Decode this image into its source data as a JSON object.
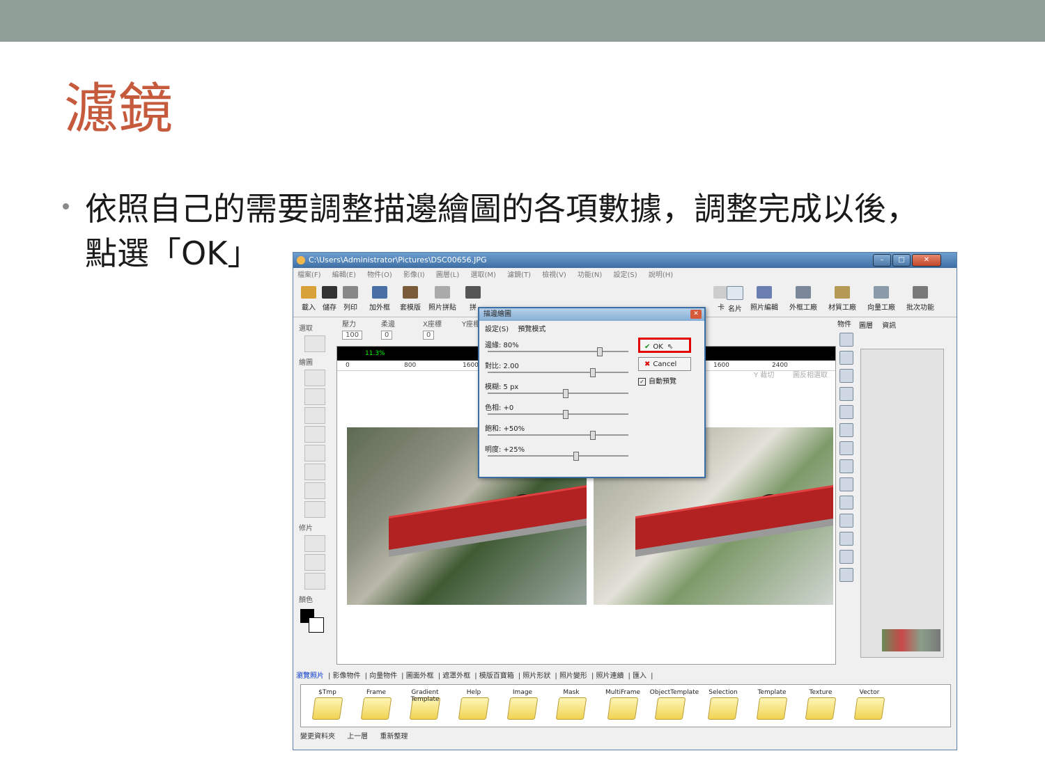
{
  "slide": {
    "title": "濾鏡",
    "bullet_line1": "依照自己的需要調整描邊繪圖的各項數據，調整完成以後，",
    "bullet_line2": "點選「OK」"
  },
  "window": {
    "title": "C:\\Users\\Administrator\\Pictures\\DSC00656.JPG",
    "menus": [
      "檔案(F)",
      "編輯(E)",
      "物件(O)",
      "影像(I)",
      "圖層(L)",
      "選取(M)",
      "濾鏡(T)",
      "檢視(V)",
      "功能(N)",
      "設定(S)",
      "說明(H)"
    ],
    "toolbar": [
      "載入",
      "儲存",
      "列印",
      "加外框",
      "套模版",
      "照片拼貼",
      "拼",
      "卡",
      "名片",
      "照片編輯",
      "外框工廠",
      "材質工廠",
      "向量工廠",
      "批次功能"
    ],
    "left_labels": [
      "選取",
      "繪圖",
      "修片",
      "顏色"
    ],
    "option_labels": [
      "壓力",
      "柔邊",
      "X座標",
      "Y座標"
    ],
    "option_values": [
      "100",
      "0",
      "0"
    ],
    "zoom": "11.3%",
    "ruler_marks": [
      "0",
      "800",
      "1600",
      "1600",
      "2400"
    ],
    "right_hint": [
      "Y 裁切",
      "圖反相選取"
    ],
    "layer_tabs": [
      "物件",
      "圖層",
      "資訊"
    ],
    "bottom_tabs": [
      "瀏覽照片",
      "影像物件",
      "向量物件",
      "圖面外框",
      "遮罩外框",
      "模版百寶箱",
      "照片形狀",
      "照片變形",
      "照片連續",
      "匯入"
    ],
    "folders": [
      "$Tmp",
      "Frame",
      "Gradient Template",
      "Help",
      "Image",
      "Mask",
      "MultiFrame",
      "ObjectTemplate",
      "Selection",
      "Template",
      "Texture",
      "Vector"
    ],
    "status": [
      "變更資料夾",
      "上一層",
      "重新整理"
    ]
  },
  "dialog": {
    "title": "描邊繪圖",
    "menu": [
      "設定(S)",
      "預覽模式"
    ],
    "sliders": [
      {
        "label": "邊緣: 80%",
        "value": 0.8
      },
      {
        "label": "對比: 2.00",
        "value": 0.75
      },
      {
        "label": "模糊: 5 px",
        "value": 0.55
      },
      {
        "label": "色相: +0",
        "value": 0.55
      },
      {
        "label": "飽和: +50%",
        "value": 0.75
      },
      {
        "label": "明度: +25%",
        "value": 0.63
      }
    ],
    "ok_label": "OK",
    "cancel_label": "Cancel",
    "preview_label": "自動預覽",
    "preview_checked": true
  },
  "colors": {
    "topbar": "#8f9f97",
    "title": "#c65a3d",
    "highlight": "#e00000"
  }
}
